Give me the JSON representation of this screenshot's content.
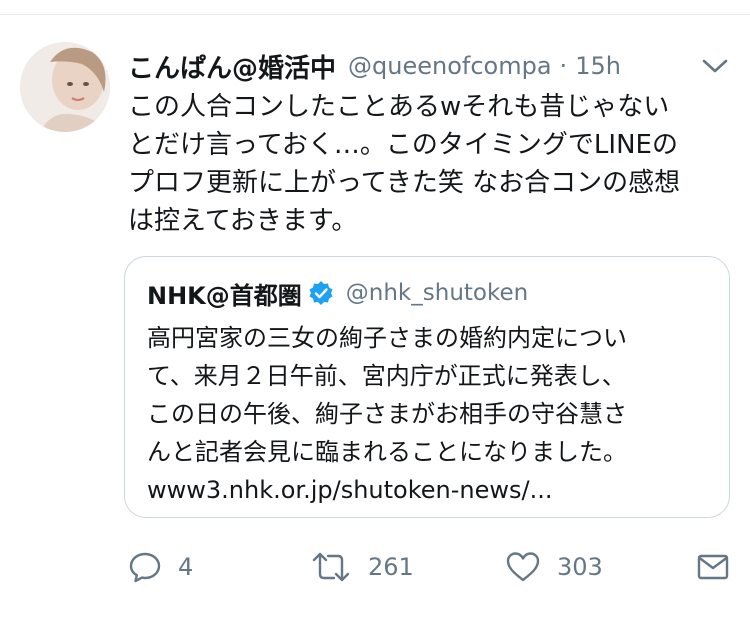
{
  "tweet": {
    "display_name": "こんぱん@婚活中",
    "handle": "@queenofcompa",
    "separator": "·",
    "time": "15h",
    "text_lines": [
      "この人合コンしたことあるwそれも昔じゃない",
      "とだけ言っておく…。このタイミングでLINEの",
      "プロフ更新に上がってきた笑 なお合コンの感想",
      "は控えておきます。"
    ]
  },
  "quote": {
    "display_name": "NHK@首都圏",
    "handle": "@nhk_shutoken",
    "text_lines": [
      "高円宮家の三女の絢子さまの婚約内定につい",
      "て、来月２日午前、宮内庁が正式に発表し、",
      "この日の午後、絢子さまがお相手の守谷慧さ",
      "んと記者会見に臨まれることになりました。",
      "www3.nhk.or.jp/shutoken-news/..."
    ]
  },
  "actions": {
    "reply_count": "4",
    "retweet_count": "261",
    "like_count": "303"
  },
  "icons": {
    "avatar": "avatar",
    "chevron": "chevron-down-icon",
    "verified": "verified-badge-icon",
    "reply": "reply-icon",
    "retweet": "retweet-icon",
    "like": "heart-icon",
    "dm": "envelope-icon"
  },
  "colors": {
    "text": "#14171a",
    "secondary": "#657786",
    "border": "#ccd6dd",
    "verified": "#1da1f2",
    "divider": "#e6ecf0"
  }
}
